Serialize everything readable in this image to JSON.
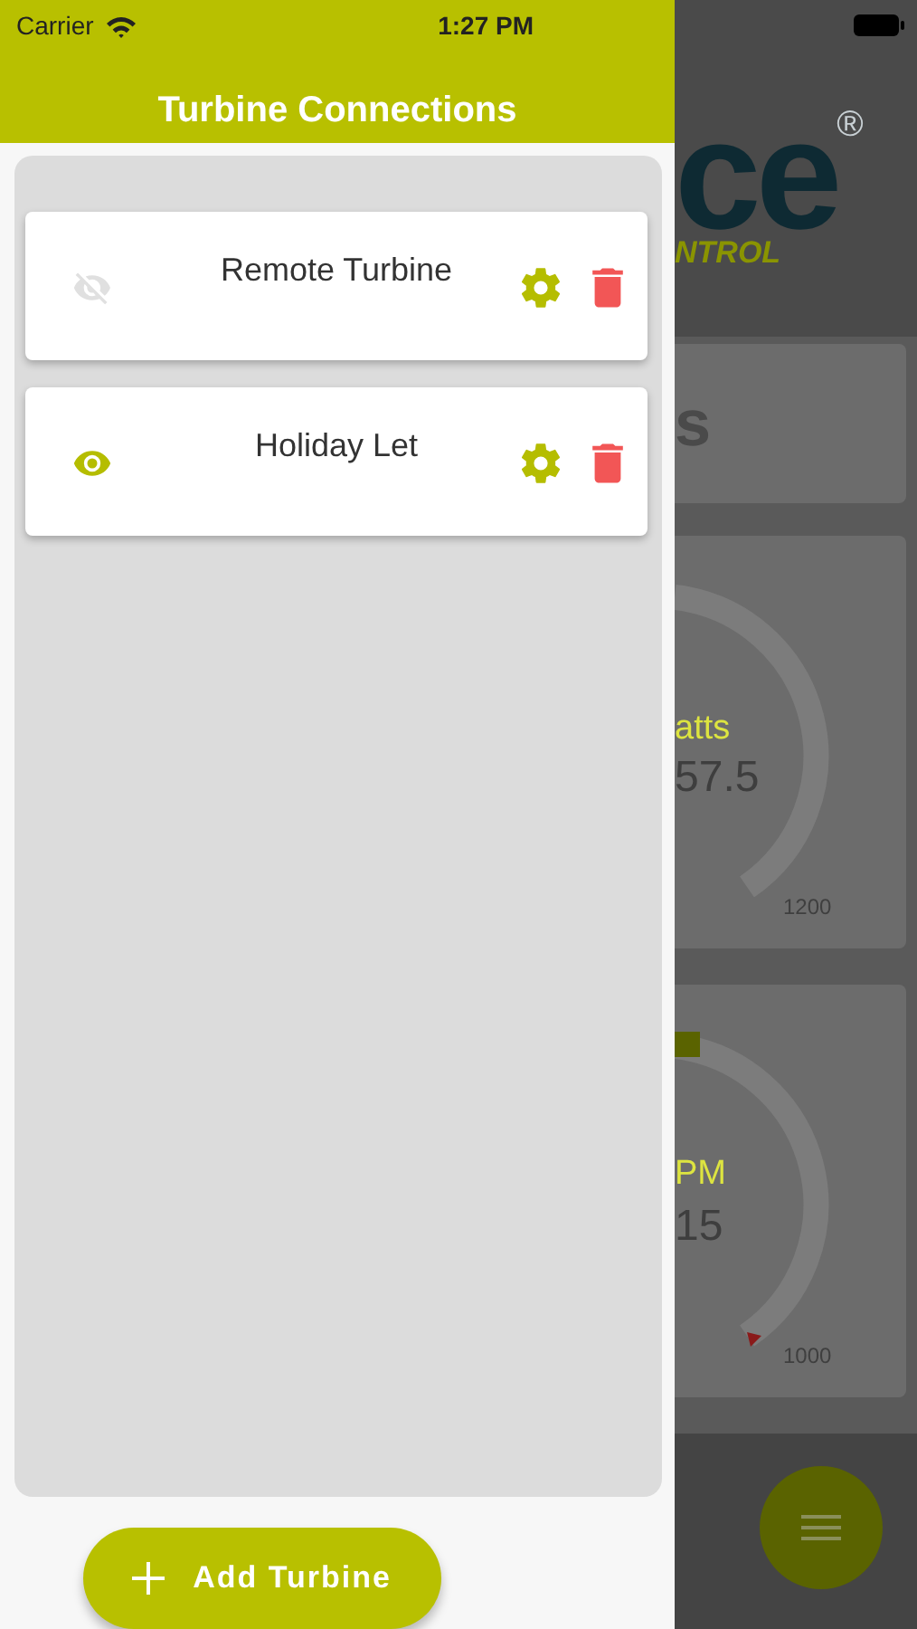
{
  "status_bar": {
    "carrier": "Carrier",
    "time": "1:27 PM"
  },
  "drawer": {
    "title": "Turbine Connections",
    "connections": [
      {
        "name": "Remote Turbine",
        "visible": false
      },
      {
        "name": "Holiday Let",
        "visible": true
      }
    ],
    "add_button": "Add Turbine"
  },
  "background_screen": {
    "logo_text": "ce",
    "registered_mark": "®",
    "logo_subtitle": "NTROL",
    "card_1_text": "s",
    "gauges": [
      {
        "label": "atts",
        "value": "57.5",
        "max": "1200",
        "has_pointer": false,
        "has_marker": false
      },
      {
        "label": "PM",
        "value": "15",
        "max": "1000",
        "has_pointer": true,
        "has_marker": true
      }
    ]
  }
}
